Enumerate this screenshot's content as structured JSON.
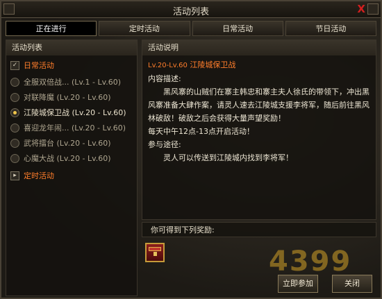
{
  "window": {
    "title": "活动列表",
    "close_symbol": "X"
  },
  "tabs": [
    {
      "label": "正在进行",
      "active": true
    },
    {
      "label": "定时活动"
    },
    {
      "label": "日常活动"
    },
    {
      "label": "节日活动"
    }
  ],
  "left_panel": {
    "header": "活动列表",
    "category_daily": {
      "box": "✓",
      "label": "日常活动"
    },
    "activities": [
      {
        "label": "全服双倍战... (Lv.1 - Lv.60)"
      },
      {
        "label": "对联降魔 (Lv.20 - Lv.60)"
      },
      {
        "label": "江陵城保卫战 (Lv.20 - Lv.60)"
      },
      {
        "label": "喜迎龙年闹... (Lv.20 - Lv.60)"
      },
      {
        "label": "武将擂台 (Lv.20 - Lv.60)"
      },
      {
        "label": "心魔大战 (Lv.20 - Lv.60)"
      }
    ],
    "selected_index": 2,
    "category_timed": {
      "box": "▸",
      "label": "定时活动"
    }
  },
  "right_panel": {
    "header": "活动说明",
    "level_range": "Lv.20-Lv.60",
    "activity_name": "江陵城保卫战",
    "content_label": "内容描述:",
    "content": "黑风寨的山贼们在寨主韩忠和寨主夫人徐氏的带领下，冲出黑风寨准备大肆作案，请灵人速去江陵城支援李将军，随后前往黑风林破敌！破敌之后会获得大量声望奖励！",
    "time_note": "每天中午12点-13点开启活动！",
    "participate_label": "参与途径:",
    "participate": "灵人可以传送到江陵城内找到李将军！"
  },
  "reward": {
    "header": "你可得到下列奖励:",
    "item_icon": "treasure-chest-icon"
  },
  "buttons": {
    "join": "立即参加",
    "close": "关闭"
  },
  "watermark": "4399"
}
